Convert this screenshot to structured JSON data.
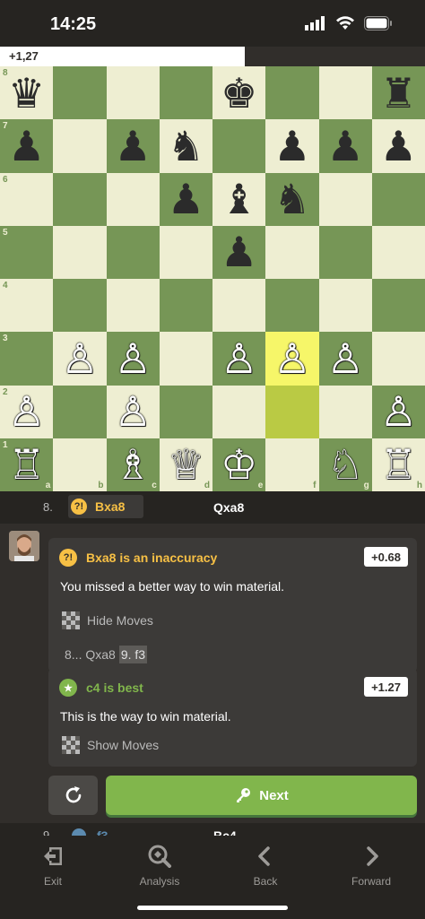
{
  "status": {
    "time": "14:25"
  },
  "eval": {
    "value": "+1,27",
    "fill_fraction": 0.576
  },
  "board": {
    "files": [
      "a",
      "b",
      "c",
      "d",
      "e",
      "f",
      "g",
      "h"
    ],
    "ranks": [
      "8",
      "7",
      "6",
      "5",
      "4",
      "3",
      "2",
      "1"
    ],
    "highlight_squares": [
      "f3",
      "f2"
    ],
    "position": {
      "a8": "♛b",
      "e8": "♚b",
      "h8": "♜b",
      "a7": "♟b",
      "c7": "♟b",
      "d7": "♞b",
      "f7": "♟b",
      "g7": "♟b",
      "h7": "♟b",
      "d6": "♟b",
      "e6": "♝b",
      "f6": "♞b",
      "e5": "♟b",
      "b3": "♙w",
      "c3": "♙w",
      "e3": "♙w",
      "f3": "♙w",
      "g3": "♙w",
      "a2": "♙w",
      "c2": "♙w",
      "h2": "♙w",
      "a1": "♖w",
      "c1": "♗w",
      "d1": "♕w",
      "e1": "♔w",
      "g1": "♘w",
      "h1": "♖w"
    }
  },
  "move_row": {
    "number": "8.",
    "white_badge": "?!",
    "white_move": "Bxa8",
    "black_move": "Qxa8"
  },
  "card1": {
    "badge": "?!",
    "title": "Bxa8 is an inaccuracy",
    "eval": "+0.68",
    "body": "You missed a better way to win material.",
    "toggle": "Hide Moves",
    "line_prefix": "8... Qxa8",
    "line_highlight": "9. f3"
  },
  "card2": {
    "badge": "★",
    "title": "c4 is best",
    "eval": "+1.27",
    "body": "This is the way to win material.",
    "toggle": "Show Moves"
  },
  "buttons": {
    "next": "Next"
  },
  "move_row2": {
    "number": "9.",
    "white_move": "f3",
    "black_move": "Bc4"
  },
  "nav": {
    "exit": "Exit",
    "analysis": "Analysis",
    "back": "Back",
    "forward": "Forward"
  }
}
